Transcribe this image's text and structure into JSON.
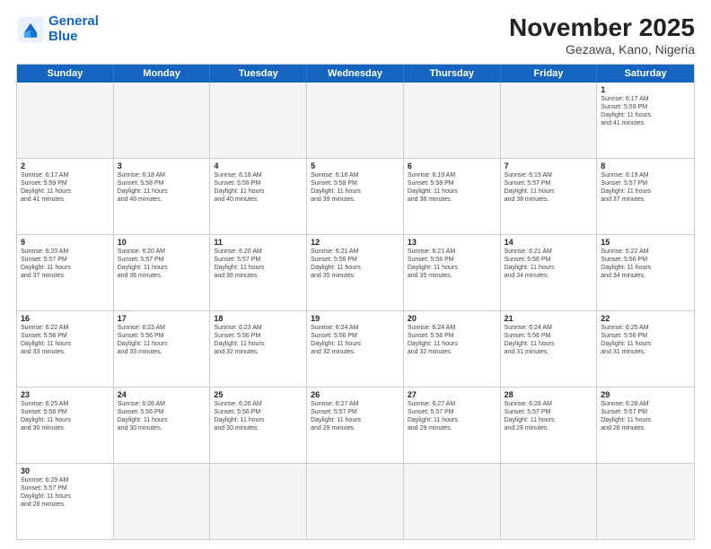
{
  "header": {
    "logo_line1": "General",
    "logo_line2": "Blue",
    "title": "November 2025",
    "subtitle": "Gezawa, Kano, Nigeria"
  },
  "weekdays": [
    "Sunday",
    "Monday",
    "Tuesday",
    "Wednesday",
    "Thursday",
    "Friday",
    "Saturday"
  ],
  "weeks": [
    [
      {
        "day": "",
        "info": ""
      },
      {
        "day": "",
        "info": ""
      },
      {
        "day": "",
        "info": ""
      },
      {
        "day": "",
        "info": ""
      },
      {
        "day": "",
        "info": ""
      },
      {
        "day": "",
        "info": ""
      },
      {
        "day": "1",
        "info": "Sunrise: 6:17 AM\nSunset: 5:59 PM\nDaylight: 11 hours\nand 41 minutes."
      }
    ],
    [
      {
        "day": "2",
        "info": "Sunrise: 6:17 AM\nSunset: 5:59 PM\nDaylight: 11 hours\nand 41 minutes."
      },
      {
        "day": "3",
        "info": "Sunrise: 6:18 AM\nSunset: 5:58 PM\nDaylight: 11 hours\nand 40 minutes."
      },
      {
        "day": "4",
        "info": "Sunrise: 6:18 AM\nSunset: 5:58 PM\nDaylight: 11 hours\nand 40 minutes."
      },
      {
        "day": "5",
        "info": "Sunrise: 6:18 AM\nSunset: 5:58 PM\nDaylight: 11 hours\nand 39 minutes."
      },
      {
        "day": "6",
        "info": "Sunrise: 6:19 AM\nSunset: 5:58 PM\nDaylight: 11 hours\nand 38 minutes."
      },
      {
        "day": "7",
        "info": "Sunrise: 6:19 AM\nSunset: 5:57 PM\nDaylight: 11 hours\nand 38 minutes."
      },
      {
        "day": "8",
        "info": "Sunrise: 6:19 AM\nSunset: 5:57 PM\nDaylight: 11 hours\nand 37 minutes."
      }
    ],
    [
      {
        "day": "9",
        "info": "Sunrise: 6:20 AM\nSunset: 5:57 PM\nDaylight: 11 hours\nand 37 minutes."
      },
      {
        "day": "10",
        "info": "Sunrise: 6:20 AM\nSunset: 5:57 PM\nDaylight: 11 hours\nand 36 minutes."
      },
      {
        "day": "11",
        "info": "Sunrise: 6:20 AM\nSunset: 5:57 PM\nDaylight: 11 hours\nand 36 minutes."
      },
      {
        "day": "12",
        "info": "Sunrise: 6:21 AM\nSunset: 5:56 PM\nDaylight: 11 hours\nand 35 minutes."
      },
      {
        "day": "13",
        "info": "Sunrise: 6:21 AM\nSunset: 5:56 PM\nDaylight: 11 hours\nand 35 minutes."
      },
      {
        "day": "14",
        "info": "Sunrise: 6:21 AM\nSunset: 5:56 PM\nDaylight: 11 hours\nand 34 minutes."
      },
      {
        "day": "15",
        "info": "Sunrise: 6:22 AM\nSunset: 5:56 PM\nDaylight: 11 hours\nand 34 minutes."
      }
    ],
    [
      {
        "day": "16",
        "info": "Sunrise: 6:22 AM\nSunset: 5:56 PM\nDaylight: 11 hours\nand 33 minutes."
      },
      {
        "day": "17",
        "info": "Sunrise: 6:23 AM\nSunset: 5:56 PM\nDaylight: 11 hours\nand 33 minutes."
      },
      {
        "day": "18",
        "info": "Sunrise: 6:23 AM\nSunset: 5:56 PM\nDaylight: 11 hours\nand 32 minutes."
      },
      {
        "day": "19",
        "info": "Sunrise: 6:24 AM\nSunset: 5:56 PM\nDaylight: 11 hours\nand 32 minutes."
      },
      {
        "day": "20",
        "info": "Sunrise: 6:24 AM\nSunset: 5:56 PM\nDaylight: 11 hours\nand 32 minutes."
      },
      {
        "day": "21",
        "info": "Sunrise: 6:24 AM\nSunset: 5:56 PM\nDaylight: 11 hours\nand 31 minutes."
      },
      {
        "day": "22",
        "info": "Sunrise: 6:25 AM\nSunset: 5:56 PM\nDaylight: 11 hours\nand 31 minutes."
      }
    ],
    [
      {
        "day": "23",
        "info": "Sunrise: 6:25 AM\nSunset: 5:56 PM\nDaylight: 11 hours\nand 30 minutes."
      },
      {
        "day": "24",
        "info": "Sunrise: 6:26 AM\nSunset: 5:56 PM\nDaylight: 11 hours\nand 30 minutes."
      },
      {
        "day": "25",
        "info": "Sunrise: 6:26 AM\nSunset: 5:56 PM\nDaylight: 11 hours\nand 30 minutes."
      },
      {
        "day": "26",
        "info": "Sunrise: 6:27 AM\nSunset: 5:57 PM\nDaylight: 11 hours\nand 29 minutes."
      },
      {
        "day": "27",
        "info": "Sunrise: 6:27 AM\nSunset: 5:57 PM\nDaylight: 11 hours\nand 29 minutes."
      },
      {
        "day": "28",
        "info": "Sunrise: 6:28 AM\nSunset: 5:57 PM\nDaylight: 11 hours\nand 28 minutes."
      },
      {
        "day": "29",
        "info": "Sunrise: 6:28 AM\nSunset: 5:57 PM\nDaylight: 11 hours\nand 28 minutes."
      }
    ],
    [
      {
        "day": "30",
        "info": "Sunrise: 6:29 AM\nSunset: 5:57 PM\nDaylight: 11 hours\nand 28 minutes."
      },
      {
        "day": "",
        "info": ""
      },
      {
        "day": "",
        "info": ""
      },
      {
        "day": "",
        "info": ""
      },
      {
        "day": "",
        "info": ""
      },
      {
        "day": "",
        "info": ""
      },
      {
        "day": "",
        "info": ""
      }
    ]
  ]
}
